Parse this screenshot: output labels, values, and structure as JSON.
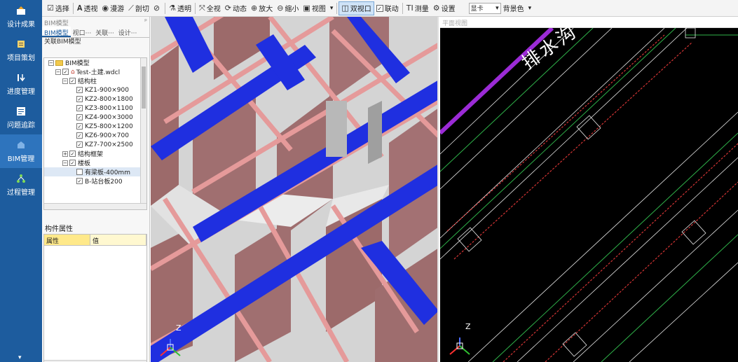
{
  "nav": {
    "items": [
      {
        "label": "设计成果",
        "icon": "design-result-icon"
      },
      {
        "label": "项目策划",
        "icon": "project-plan-icon"
      },
      {
        "label": "进度管理",
        "icon": "progress-icon"
      },
      {
        "label": "问题追踪",
        "icon": "issue-icon"
      },
      {
        "label": "BIM管理",
        "icon": "bim-icon"
      },
      {
        "label": "过程管理",
        "icon": "process-icon"
      }
    ],
    "active": "BIM管理"
  },
  "toolbar": {
    "select": "选择",
    "perspective": "透视",
    "roam": "漫游",
    "section": "剖切",
    "transparent": "透明",
    "full_view": "全视",
    "dynamic": "动态",
    "zoom_in": "放大",
    "zoom_out": "缩小",
    "view": "视图",
    "dual_view": "双视口",
    "link": "联动",
    "measure": "测量",
    "settings": "设置",
    "gpu_select": "显卡",
    "background": "背景色"
  },
  "side": {
    "panel_caption": "BIM模型",
    "pin": "ᵖ",
    "tabs": [
      "BIM模型",
      "视口···",
      "关联···",
      "设计···"
    ],
    "associated_label": "关联BIM模型",
    "tree": {
      "root": "BIM模型",
      "file": "Test-土建.wdcl",
      "group1": "结构柱",
      "columns": [
        "KZ1-900×900",
        "KZ2-800×1800",
        "KZ3-800×1100",
        "KZ4-900×3000",
        "KZ5-800×1200",
        "KZ6-900×700",
        "KZ7-700×2500"
      ],
      "group2": "结构框架",
      "group3": "楼板",
      "slabs": [
        "有梁板-400mm",
        "B-站台板200"
      ]
    },
    "props_title": "构件属性",
    "props_headers": [
      "属性",
      "值"
    ]
  },
  "view3d": {
    "axis_label": "Z"
  },
  "viewplan": {
    "caption": "平面视图",
    "drain_label": "排水沟",
    "axis_label": "Z"
  }
}
